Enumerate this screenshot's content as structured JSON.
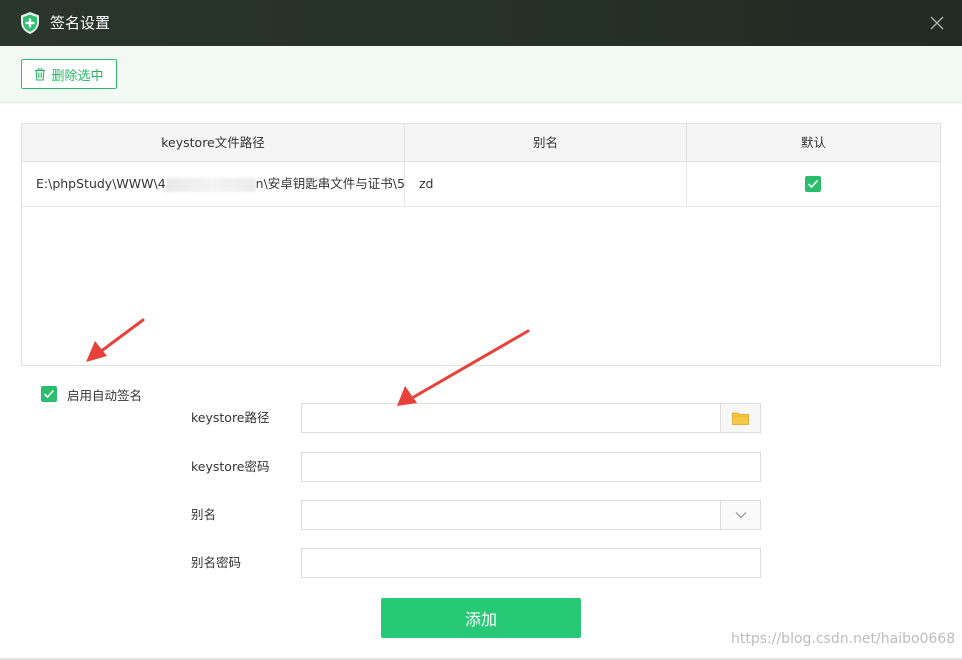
{
  "window": {
    "title": "签名设置"
  },
  "toolbar": {
    "delete_label": "删除选中"
  },
  "table": {
    "headers": [
      "keystore文件路径",
      "别名",
      "默认"
    ],
    "rows": [
      {
        "path_start": "E:\\phpStudy\\WWW\\4",
        "path_end": "n\\安卓钥匙串文件与证书\\5...",
        "alias": "zd",
        "default": true
      }
    ]
  },
  "auto_sign": {
    "label": "启用自动签名",
    "checked": true
  },
  "form": {
    "keystore_path_label": "keystore路径",
    "keystore_password_label": "keystore密码",
    "alias_label": "别名",
    "alias_password_label": "别名密码",
    "keystore_path_value": "",
    "keystore_password_value": "",
    "alias_value": "",
    "alias_password_value": ""
  },
  "add_button": {
    "label": "添加"
  },
  "watermark": "https://blog.csdn.net/haibo0668",
  "colors": {
    "accent": "#27c977",
    "titlebar": "#253026",
    "arrow": "#e8413a"
  },
  "icons": [
    "shield-plus-icon",
    "close-icon",
    "trash-icon",
    "check-icon",
    "folder-icon",
    "chevron-down-icon"
  ]
}
